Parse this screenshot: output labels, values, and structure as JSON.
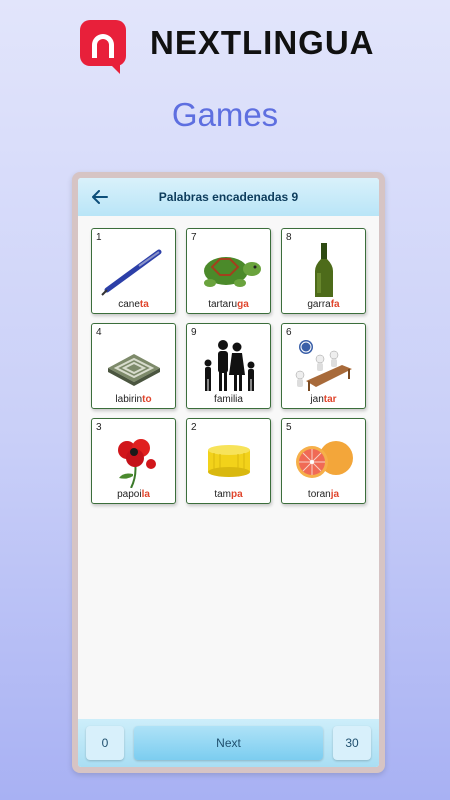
{
  "brand": {
    "name": "NEXTLINGUA",
    "logo_icon": "nextlingua-logo-icon"
  },
  "section_title": "Games",
  "app": {
    "title": "Palabras encadenadas 9",
    "back_icon": "back-arrow-icon"
  },
  "cards": [
    {
      "num": "1",
      "prefix": "cane",
      "highlight": "ta",
      "icon": "pen-icon"
    },
    {
      "num": "7",
      "prefix": "tartaru",
      "highlight": "ga",
      "icon": "turtle-icon"
    },
    {
      "num": "8",
      "prefix": "garra",
      "highlight": "fa",
      "icon": "bottle-icon"
    },
    {
      "num": "4",
      "prefix": "labirin",
      "highlight": "to",
      "icon": "maze-icon"
    },
    {
      "num": "9",
      "prefix": "familia",
      "highlight": "",
      "icon": "family-icon"
    },
    {
      "num": "6",
      "prefix": "jan",
      "highlight": "tar",
      "icon": "dinner-table-icon"
    },
    {
      "num": "3",
      "prefix": "papoi",
      "highlight": "la",
      "icon": "poppy-flower-icon"
    },
    {
      "num": "2",
      "prefix": "tam",
      "highlight": "pa",
      "icon": "cap-icon"
    },
    {
      "num": "5",
      "prefix": "toran",
      "highlight": "ja",
      "icon": "grapefruit-icon"
    }
  ],
  "footer": {
    "left_count": "0",
    "next_label": "Next",
    "right_count": "30"
  },
  "colors": {
    "highlight": "#e0452c",
    "brand_red": "#e8203a",
    "section_title": "#5e6fe0"
  }
}
